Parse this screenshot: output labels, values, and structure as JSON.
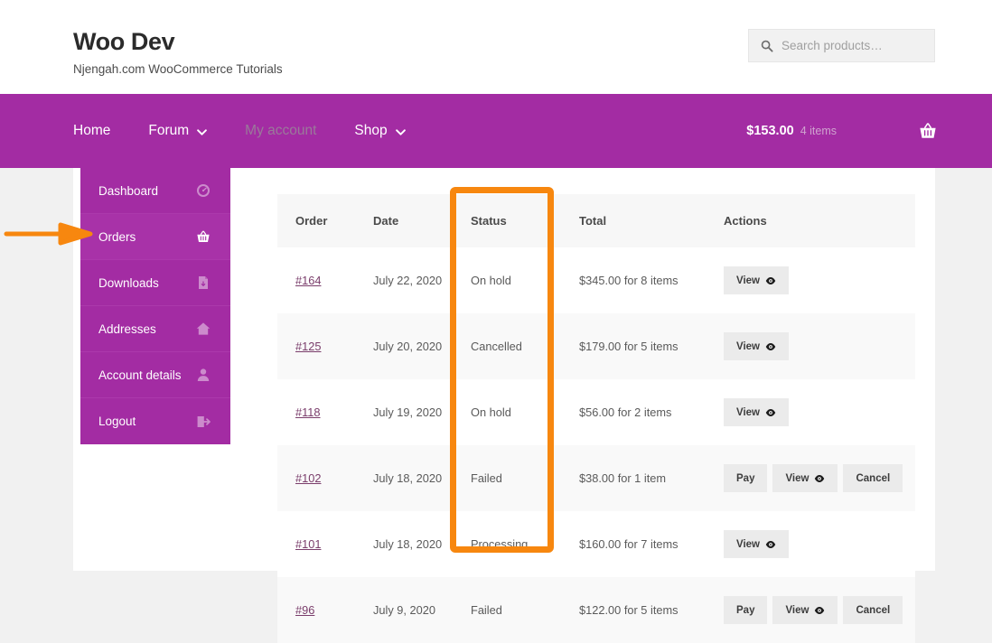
{
  "site": {
    "brand_title": "Woo Dev",
    "brand_tagline": "Njengah.com WooCommerce Tutorials"
  },
  "search": {
    "icon": "search-icon",
    "placeholder": "Search products…",
    "value": ""
  },
  "nav": {
    "items": [
      {
        "label": "Home",
        "has_caret": false,
        "state": "normal"
      },
      {
        "label": "Forum",
        "has_caret": true,
        "state": "normal"
      },
      {
        "label": "My account",
        "has_caret": false,
        "state": "dim"
      },
      {
        "label": "Shop",
        "has_caret": true,
        "state": "normal"
      }
    ],
    "cart": {
      "amount": "$153.00",
      "count": "4 items",
      "icon": "basket-icon"
    }
  },
  "account_nav": {
    "items": [
      {
        "label": "Dashboard",
        "icon": "gauge-icon",
        "active": false
      },
      {
        "label": "Orders",
        "icon": "basket-icon",
        "active": true
      },
      {
        "label": "Downloads",
        "icon": "file-download-icon",
        "active": false
      },
      {
        "label": "Addresses",
        "icon": "home-icon",
        "active": false
      },
      {
        "label": "Account details",
        "icon": "user-icon",
        "active": false
      },
      {
        "label": "Logout",
        "icon": "logout-icon",
        "active": false
      }
    ]
  },
  "orders": {
    "columns": [
      "Order",
      "Date",
      "Status",
      "Total",
      "Actions"
    ],
    "rows": [
      {
        "order": "#164",
        "date": "July 22, 2020",
        "status": "On hold",
        "total": "$345.00 for 8 items",
        "actions": [
          "View"
        ]
      },
      {
        "order": "#125",
        "date": "July 20, 2020",
        "status": "Cancelled",
        "total": "$179.00 for 5 items",
        "actions": [
          "View"
        ]
      },
      {
        "order": "#118",
        "date": "July 19, 2020",
        "status": "On hold",
        "total": "$56.00 for 2 items",
        "actions": [
          "View"
        ]
      },
      {
        "order": "#102",
        "date": "July 18, 2020",
        "status": "Failed",
        "total": "$38.00 for 1 item",
        "actions": [
          "Pay",
          "View",
          "Cancel"
        ]
      },
      {
        "order": "#101",
        "date": "July 18, 2020",
        "status": "Processing",
        "total": "$160.00 for 7 items",
        "actions": [
          "View"
        ]
      },
      {
        "order": "#96",
        "date": "July 9, 2020",
        "status": "Failed",
        "total": "$122.00 for 5 items",
        "actions": [
          "Pay",
          "View",
          "Cancel"
        ]
      }
    ]
  },
  "annotations": {
    "highlight_color": "#f7870f",
    "highlight_target": "Status",
    "arrow_color": "#f7870f",
    "arrow_target": "Orders"
  },
  "colors": {
    "brand_purple": "#a32ca3",
    "page_background": "#f1f1f1",
    "link": "#7a3d6b",
    "button_background": "#ebebeb"
  }
}
